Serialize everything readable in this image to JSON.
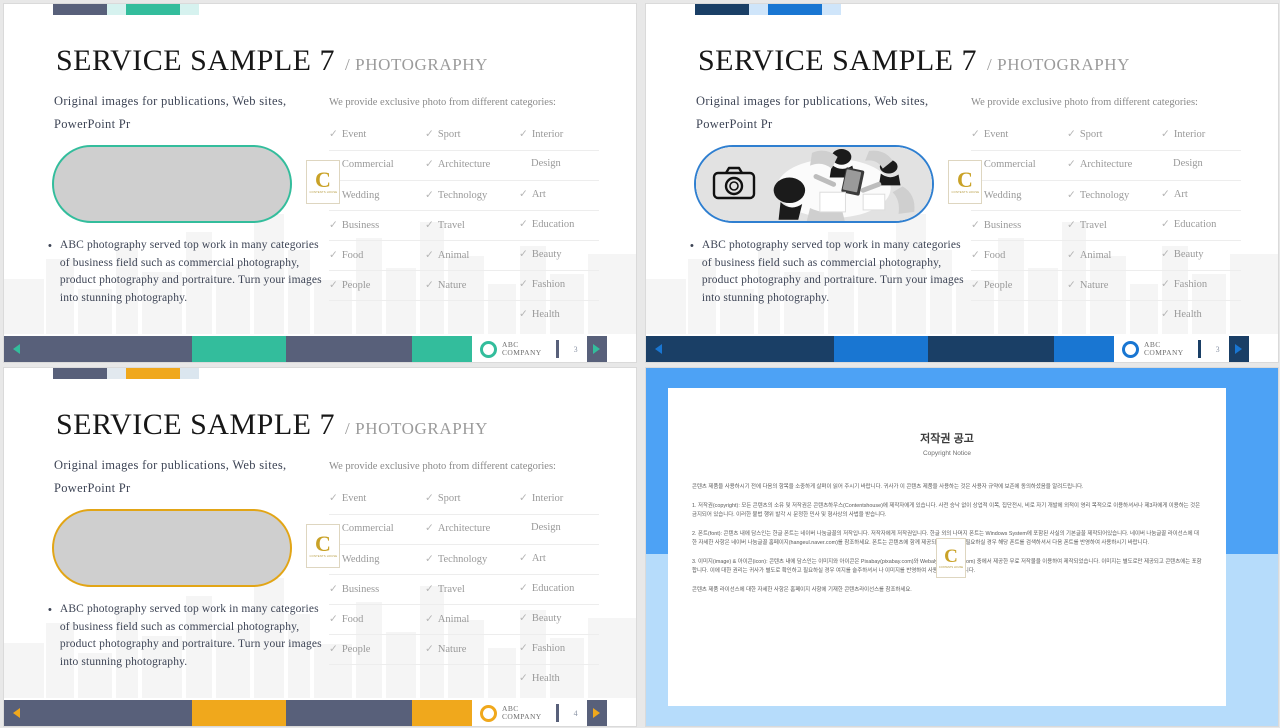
{
  "theme": {
    "teal": "#33bd9c",
    "teal_light": "#d6f2ef",
    "slate": "#58607a",
    "blue_dark": "#1a3f66",
    "blue": "#1976d2",
    "blue_light": "#cfe5fa",
    "gold": "#f0a81c",
    "gold_light": "#e2e9ef",
    "panel_bg": "#4da2f5"
  },
  "slide_common": {
    "title_main": "SERVICE SAMPLE 7",
    "title_sub": "/ PHOTOGRAPHY",
    "lead": "Original images for publications, Web sites, PowerPoint Pr",
    "bullet_mark": "•",
    "bullet_text": "ABC photography served top work in many categories of business field such as commercial photography, product photography and portraiture. Turn your images into stunning photography.",
    "categories_head": "We provide exclusive photo from different categories:",
    "check": "✓",
    "watermark_letter": "C",
    "watermark_caption": "CONTENTS  HOUSE",
    "footer_logo_name_1": "ABC",
    "footer_logo_name_2": "COMPANY",
    "categories_col1": [
      "Event",
      "Commercial",
      "Wedding",
      "Business",
      "Food",
      "People"
    ],
    "categories_col2": [
      "Sport",
      "Architecture",
      "Technology",
      "Travel",
      "Animal",
      "Nature"
    ],
    "categories_col3": [
      "Interior",
      "Design",
      "Art",
      "Education",
      "Beauty",
      "Fashion",
      "Health"
    ]
  },
  "slides": [
    {
      "id": "slide-teal",
      "accent": "#33bd9c",
      "accent_dark": "#58607a",
      "deco_light": "#d6f2ef",
      "page": "3",
      "photo": "placeholder"
    },
    {
      "id": "slide-blue",
      "accent": "#1976d2",
      "accent_dark": "#1a3f66",
      "deco_light": "#cfe5fa",
      "page": "3",
      "photo": "people-around-table-photo"
    },
    {
      "id": "slide-gold",
      "accent": "#f0a81c",
      "accent_dark": "#58607a",
      "deco_light": "#e2e9ef",
      "page": "4",
      "photo": "placeholder"
    }
  ],
  "copyright_slide": {
    "title": "저작권 공고",
    "subtitle": "Copyright Notice",
    "paragraphs": [
      "콘텐츠 제품을 사용하시기 전에 다음의 항목을 소중하게 살펴이 읽어 주시기 바랍니다. 귀사가 이 콘텐츠 제품을 사용하는 것은 사용자 규약에 보존에 동의하셨음을 알려드립니다.",
      "1. 저작권(copyright): 모든 콘텐츠의 소유 및 저작권은 콘텐츠하우스(Contentshouse)에 제작자에게 있습니다. 사전 승낙 없이 상업적 이목, 집단전시, 비로 자기 개발에 외적이 영리 목적으로 이용하셔서나 제3자에게 이용하는 것은 금지되어 있습니다. 이러한 불법 행위 발각 시 문정한 민사 및 형사상의 사법을 받습니다.",
      "2. 폰트(font): 콘텐츠 내에 담스인는 한글 폰트는 네이버 나눔글꼴의 저작입니다. 저작자에게 저작권입니다. 한글 외의 나머지 폰트는 Windows System에 포함된 사실의 기본글꼴 제작되어있습니다. 네이버 나눔글꼴 라이선스에 대한 자세한 사항은 네이버 나눔글꼴 홈페이지(hangeul.naver.com)를 참조하세요. 폰트는 콘텐츠에 함께 제공되지 않으므로, 필요하실 경우 해당 폰트를 검색하셔서 다음 폰트를 반영하여 사용하시기 바랍니다.",
      "3. 이미지(image) & 아이콘(icon): 콘텐츠 내에 담스인는 이미지와 아이콘은 Pixabay(pixabay.com)와 Webalys(webalys.com) 중에서 제공한 무료 저작물을 이용하여 제작되었습니다. 이미지는 별도로만 제공되고 콘텐츠에는 포함합니다. 이에 대한 권리는 귀사가 별도로 확인하고 필요하실 경우 여지를 술주하셔서 나 이미지를 반영하여 사용하시기 바랍니다.",
      "콘텐츠 제품 라이선스에 대한 자세한 사항은 홈페이지 사항에 기재한 콘텐츠라이선스를 참조하세요."
    ],
    "watermark_letter": "C",
    "watermark_caption": "CONTENTS  HOUSE"
  }
}
